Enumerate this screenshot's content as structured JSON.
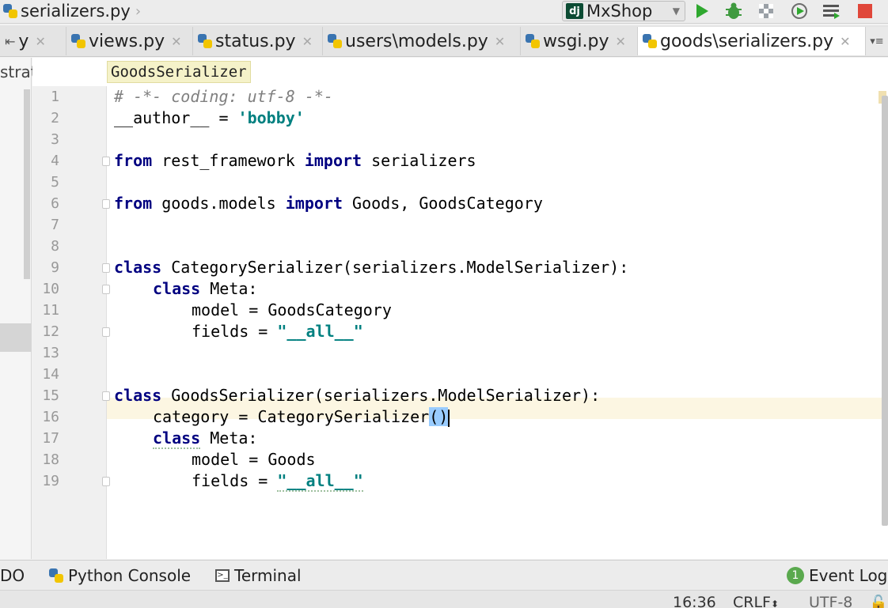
{
  "titlebar": {
    "breadcrumb": "serializers.py",
    "run_config": "MxShop"
  },
  "tabs": [
    {
      "label": "y"
    },
    {
      "label": "views.py"
    },
    {
      "label": "status.py"
    },
    {
      "label": "users\\models.py"
    },
    {
      "label": "wsgi.py"
    },
    {
      "label": "goods\\serializers.py",
      "active": true
    }
  ],
  "left_panel": {
    "label": "strat"
  },
  "editor": {
    "structure_crumb": "GoodsSerializer",
    "current_line": 16,
    "line_numbers": [
      "1",
      "2",
      "3",
      "4",
      "5",
      "6",
      "7",
      "8",
      "9",
      "10",
      "11",
      "12",
      "13",
      "14",
      "15",
      "16",
      "17",
      "18",
      "19"
    ],
    "code": {
      "l1": "# -*- coding: utf-8 -*-",
      "l2a": "__author__ = ",
      "l2b": "'bobby'",
      "kw_from": "from",
      "kw_import": "import",
      "kw_class": "class",
      "l4a": " rest_framework ",
      "l4b": " serializers",
      "l6a": " goods.models ",
      "l6b": " Goods, GoodsCategory",
      "l9": " CategorySerializer(serializers.ModelSerializer):",
      "l10": " Meta:",
      "l11": "model = GoodsCategory",
      "l12a": "fields = ",
      "l12b": "\"__all__\"",
      "l15": " GoodsSerializer(serializers.ModelSerializer):",
      "l16a": "category = CategorySerializer",
      "l16b": "()",
      "l17": " Meta:",
      "l18": "model = Goods",
      "l19a": "fields = ",
      "l19b": "\"__all__\""
    }
  },
  "bottom_tools": {
    "todo": "DO",
    "python_console": "Python Console",
    "terminal": "Terminal",
    "event_log": "Event Log",
    "event_count": "1"
  },
  "status": {
    "position": "16:36",
    "line_sep": "CRLF",
    "encoding": "UTF-8"
  },
  "colors": {
    "keyword": "#000080",
    "string": "#008080",
    "caret_line": "#fcf6e2",
    "run_green": "#2fa82f",
    "stop_red": "#e0473a"
  }
}
